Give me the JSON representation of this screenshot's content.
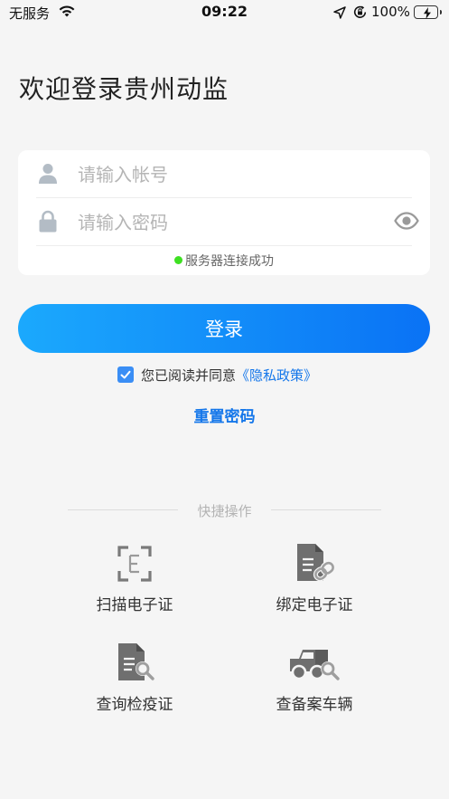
{
  "status_bar": {
    "carrier": "无服务",
    "time": "09:22",
    "battery": "100%"
  },
  "welcome_title": "欢迎登录贵州动监",
  "form": {
    "account_placeholder": "请输入帐号",
    "password_placeholder": "请输入密码",
    "server_status": "服务器连接成功"
  },
  "login_button": "登录",
  "agreement": {
    "text": "您已阅读并同意",
    "policy_link": "《隐私政策》",
    "checked": true
  },
  "reset_password": "重置密码",
  "quick_actions": {
    "title": "快捷操作",
    "items": [
      {
        "label": "扫描电子证",
        "icon": "scan-icon"
      },
      {
        "label": "绑定电子证",
        "icon": "document-link-icon"
      },
      {
        "label": "查询检疫证",
        "icon": "document-search-icon"
      },
      {
        "label": "查备案车辆",
        "icon": "truck-search-icon"
      }
    ]
  },
  "colors": {
    "primary": "#1577ea",
    "gradient_start": "#1ba9fd",
    "gradient_end": "#0a72f5",
    "success_dot": "#3ee022"
  }
}
